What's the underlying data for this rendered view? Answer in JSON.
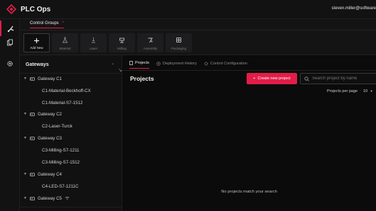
{
  "app": {
    "title": "PLC Ops",
    "user": "steven.miller@software"
  },
  "rail": {
    "items": [
      "control-icon",
      "files-icon",
      "settings-icon"
    ]
  },
  "control_groups": {
    "label": "Control Groups"
  },
  "toolbar": {
    "items": [
      {
        "label": "Add New",
        "icon": "plus-icon"
      },
      {
        "label": "Material",
        "icon": "flask-icon"
      },
      {
        "label": "Laser",
        "icon": "laser-icon"
      },
      {
        "label": "Milling",
        "icon": "milling-icon"
      },
      {
        "label": "Assembly",
        "icon": "assembly-icon"
      },
      {
        "label": "Packaging",
        "icon": "packaging-icon"
      }
    ]
  },
  "sidebar": {
    "title": "Gateways",
    "tree": [
      {
        "gateway": "Gateway C1",
        "devices": [
          "C1-Material-Beckhoff-CX",
          "C1-Material-S7-1512"
        ]
      },
      {
        "gateway": "Gateway C2",
        "devices": [
          "C2-Laser-Turck"
        ]
      },
      {
        "gateway": "Gateway C3",
        "devices": [
          "C3-Milling-S7-1211",
          "C3-Milling-S7-1512"
        ]
      },
      {
        "gateway": "Gateway C4",
        "devices": [
          "C4-LED-S7-1211C"
        ]
      },
      {
        "gateway": "Gateway C5",
        "devices": []
      }
    ]
  },
  "main": {
    "tabs": [
      {
        "label": "Projects",
        "active": true
      },
      {
        "label": "Deployment History",
        "active": false
      },
      {
        "label": "Control Configuration",
        "active": false
      }
    ],
    "title": "Projects",
    "new_button": "Create new project",
    "search_placeholder": "Search project by name",
    "per_page_label": "Projects per page",
    "per_page_value": "10",
    "empty_text": "No projects match your search"
  },
  "colors": {
    "accent": "#e11d48",
    "background": "#0b0b0c",
    "panel": "#121213"
  }
}
